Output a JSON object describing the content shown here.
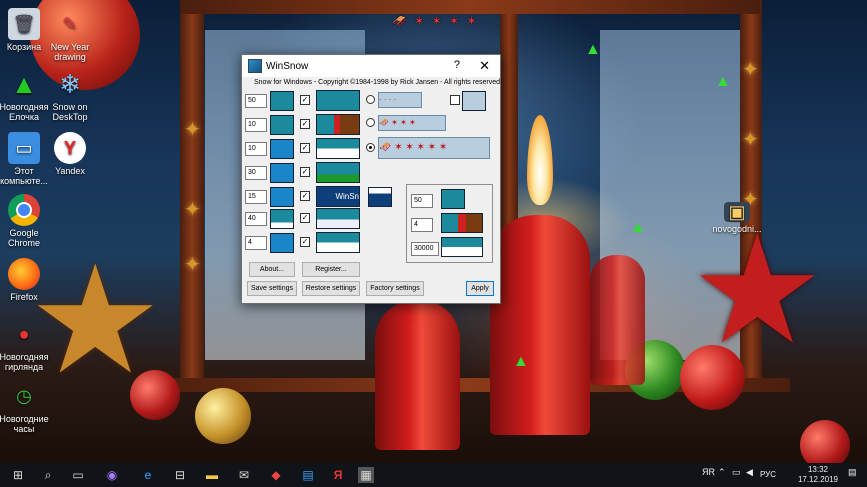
{
  "desktop_icons": [
    {
      "label": "Корзина",
      "icon": "recycle-bin-icon",
      "color": "#cfd8e0"
    },
    {
      "label": "New Year drawing",
      "icon": "pencils-icon",
      "color": "#e34"
    },
    {
      "label": "Новогодняя Елочка",
      "icon": "christmas-tree-icon",
      "color": "#2a2"
    },
    {
      "label": "Snow on DeskTop",
      "icon": "snowflake-icon",
      "color": "#5af"
    },
    {
      "label": "Этот компьюте...",
      "icon": "computer-icon",
      "color": "#3b8de0"
    },
    {
      "label": "Yandex",
      "icon": "yandex-browser-icon",
      "color": "#ddd"
    },
    {
      "label": "Google Chrome",
      "icon": "chrome-icon",
      "color": "#3a9"
    },
    {
      "label": "Firefox",
      "icon": "firefox-icon",
      "color": "#f70"
    },
    {
      "label": "Новогодняя гирлянда",
      "icon": "garland-icon",
      "color": "#c33"
    },
    {
      "label": "Новогодние часы",
      "icon": "clock-icon",
      "color": "#2a3"
    },
    {
      "label": "novogodni...",
      "icon": "image-file-icon",
      "color": "#345"
    }
  ],
  "window": {
    "title": "WinSnow",
    "help": "?",
    "close": "✕",
    "header": "Snow for Windows - Copyright ©1984-1998 by Rick Jansen - All rights reserved",
    "rows": [
      {
        "value": "50",
        "checked": true
      },
      {
        "value": "10",
        "checked": true
      },
      {
        "value": "10",
        "checked": true
      },
      {
        "value": "30",
        "checked": true
      },
      {
        "value": "15",
        "checked": true
      },
      {
        "value": "40",
        "checked": true
      },
      {
        "value": "4",
        "checked": true
      }
    ],
    "preview_label": "WinSn",
    "sleigh_options": [
      {
        "selected": false
      },
      {
        "selected": false
      },
      {
        "selected": true
      }
    ],
    "reindeer_checkbox": false,
    "group": {
      "fields": [
        "50",
        "4",
        "30000"
      ]
    },
    "buttons": {
      "about": "About...",
      "register": "Register...",
      "save": "Save settings",
      "restore": "Restore settings",
      "factory": "Factory settings",
      "apply": "Apply"
    }
  },
  "taskbar": {
    "lang": "РУС",
    "time": "13:32",
    "date": "17.12.2019",
    "pen": "ЯR"
  },
  "colors": {
    "taskbar": "#101418",
    "window_bg": "#f0f0f0",
    "accent_blue": "#1b6fb0"
  }
}
